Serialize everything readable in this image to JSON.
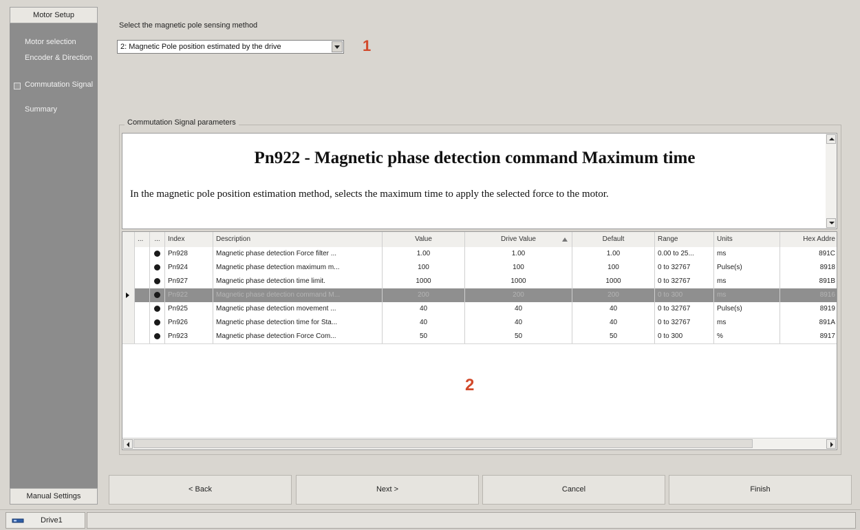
{
  "sidebar": {
    "header": "Motor Setup",
    "items": [
      {
        "label": "Motor selection"
      },
      {
        "label": "Encoder & Direction"
      },
      {
        "label": "Commutation Signal"
      },
      {
        "label": "Summary"
      }
    ],
    "footer": "Manual Settings"
  },
  "method": {
    "label": "Select the magnetic pole sensing method",
    "selected": "2: Magnetic Pole position estimated by the drive"
  },
  "callouts": {
    "one": "1",
    "two": "2"
  },
  "group": {
    "title": "Commutation Signal parameters"
  },
  "help": {
    "title": "Pn922 - Magnetic phase detection command Maximum time",
    "text": "In the magnetic pole position estimation method, selects the maximum time to apply the selected force to the motor."
  },
  "grid": {
    "columns": {
      "a": "...",
      "b": "...",
      "index": "Index",
      "description": "Description",
      "value": "Value",
      "drive_value": "Drive Value",
      "default": "Default",
      "range": "Range",
      "units": "Units",
      "hex": "Hex Addre"
    },
    "rows": [
      {
        "index": "Pn928",
        "description": "Magnetic phase detection Force filter ...",
        "value": "1.00",
        "drive_value": "1.00",
        "default": "1.00",
        "range": "0.00 to 25...",
        "units": "ms",
        "hex": "891C"
      },
      {
        "index": "Pn924",
        "description": "Magnetic phase detection maximum m...",
        "value": "100",
        "drive_value": "100",
        "default": "100",
        "range": "0 to 32767",
        "units": "Pulse(s)",
        "hex": "8918"
      },
      {
        "index": "Pn927",
        "description": "Magnetic phase detection time limit.",
        "value": "1000",
        "drive_value": "1000",
        "default": "1000",
        "range": "0 to 32767",
        "units": "ms",
        "hex": "891B"
      },
      {
        "index": "Pn922",
        "description": "Magnetic phase detection command M...",
        "value": "200",
        "drive_value": "200",
        "default": "200",
        "range": "0 to 300",
        "units": "ms",
        "hex": "8916"
      },
      {
        "index": "Pn925",
        "description": "Magnetic phase detection movement ...",
        "value": "40",
        "drive_value": "40",
        "default": "40",
        "range": "0 to 32767",
        "units": "Pulse(s)",
        "hex": "8919"
      },
      {
        "index": "Pn926",
        "description": "Magnetic phase detection time for Sta...",
        "value": "40",
        "drive_value": "40",
        "default": "40",
        "range": "0 to 32767",
        "units": "ms",
        "hex": "891A"
      },
      {
        "index": "Pn923",
        "description": "Magnetic phase detection Force Com...",
        "value": "50",
        "drive_value": "50",
        "default": "50",
        "range": "0 to 300",
        "units": "%",
        "hex": "8917"
      }
    ],
    "selected_row": 3
  },
  "buttons": {
    "back": "< Back",
    "next": "Next >",
    "cancel": "Cancel",
    "finish": "Finish"
  },
  "statusbar": {
    "drive_label": "Drive1"
  },
  "colors": {
    "callout": "#d2492a",
    "sidebar": "#8c8c8c",
    "selected_row": "#8f8f8f"
  }
}
